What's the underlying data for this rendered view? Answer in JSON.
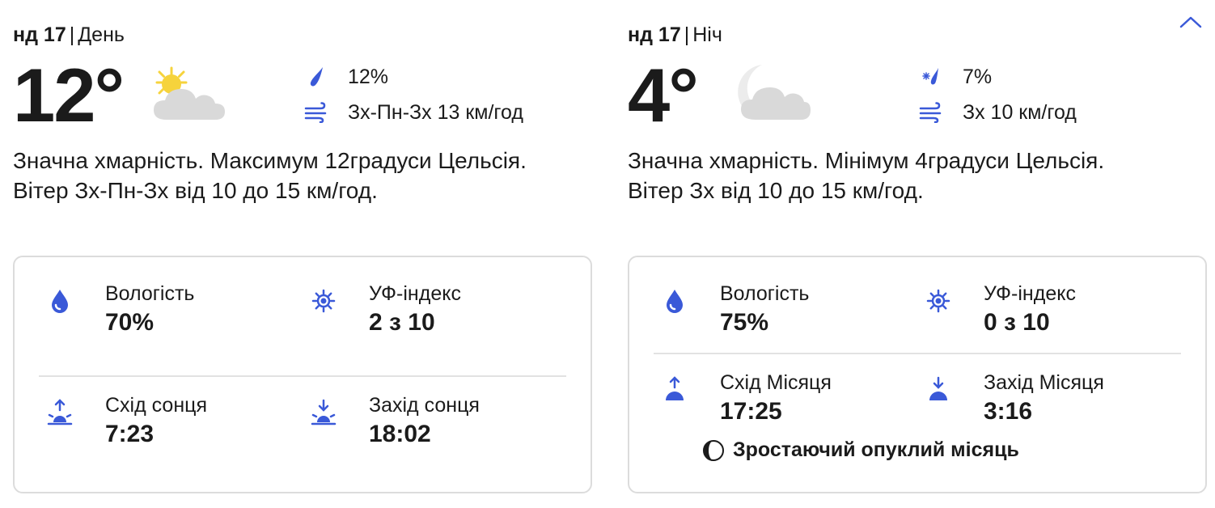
{
  "day": {
    "date": "нд 17",
    "period": "День",
    "temperature": "12°",
    "weather_icon": "partly-cloudy-sun-icon",
    "precip": "12%",
    "wind": "Зх-Пн-Зх 13 км/год",
    "description": "Значна хмарність. Максимум 12градуси Цельсія. Вітер Зх-Пн-Зх від 10 до 15 км/год.",
    "details": {
      "humidity_label": "Вологість",
      "humidity_value": "70%",
      "uv_label": "УФ-індекс",
      "uv_value": "2 з 10",
      "sunrise_label": "Схід сонця",
      "sunrise_value": "7:23",
      "sunset_label": "Захід сонця",
      "sunset_value": "18:02"
    }
  },
  "night": {
    "date": "нд 17",
    "period": "Ніч",
    "temperature": "4°",
    "weather_icon": "partly-cloudy-moon-icon",
    "precip": "7%",
    "wind": "Зх 10 км/год",
    "description": "Значна хмарність. Мінімум 4градуси Цельсія. Вітер Зх від 10 до 15 км/год.",
    "details": {
      "humidity_label": "Вологість",
      "humidity_value": "75%",
      "uv_label": "УФ-індекс",
      "uv_value": "0 з 10",
      "moonrise_label": "Схід Місяця",
      "moonrise_value": "17:25",
      "moonset_label": "Захід Місяця",
      "moonset_value": "3:16",
      "moon_phase": "Зростаючий опуклий місяць"
    }
  },
  "colors": {
    "accent": "#3a59d8",
    "text": "#1b1b1b",
    "border": "#dcdcdc",
    "sun": "#f6d33c",
    "cloud": "#d9d9d9"
  }
}
